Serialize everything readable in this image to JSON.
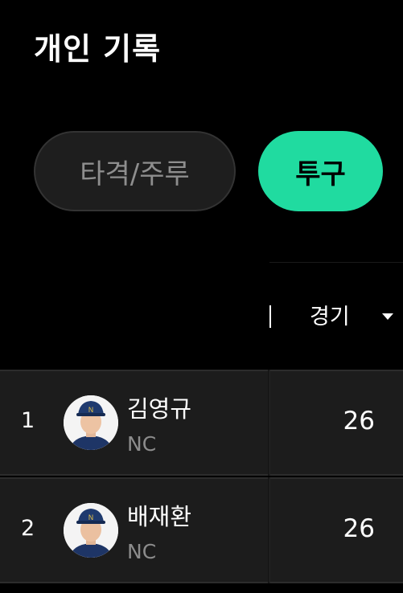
{
  "page": {
    "title": "개인 기록"
  },
  "tabs": [
    {
      "label": "타격/주루",
      "selected": false
    },
    {
      "label": "투구",
      "selected": true
    }
  ],
  "table": {
    "column_header": "경기",
    "sort_icon": "caret-down-icon",
    "rows": [
      {
        "rank": "1",
        "name": "김영규",
        "team": "NC",
        "games": "26"
      },
      {
        "rank": "2",
        "name": "배재환",
        "team": "NC",
        "games": "26"
      }
    ]
  },
  "colors": {
    "accent": "#20dba0",
    "background": "#000000",
    "row_background": "#1c1c1c",
    "muted_text": "#8c8c8c"
  }
}
